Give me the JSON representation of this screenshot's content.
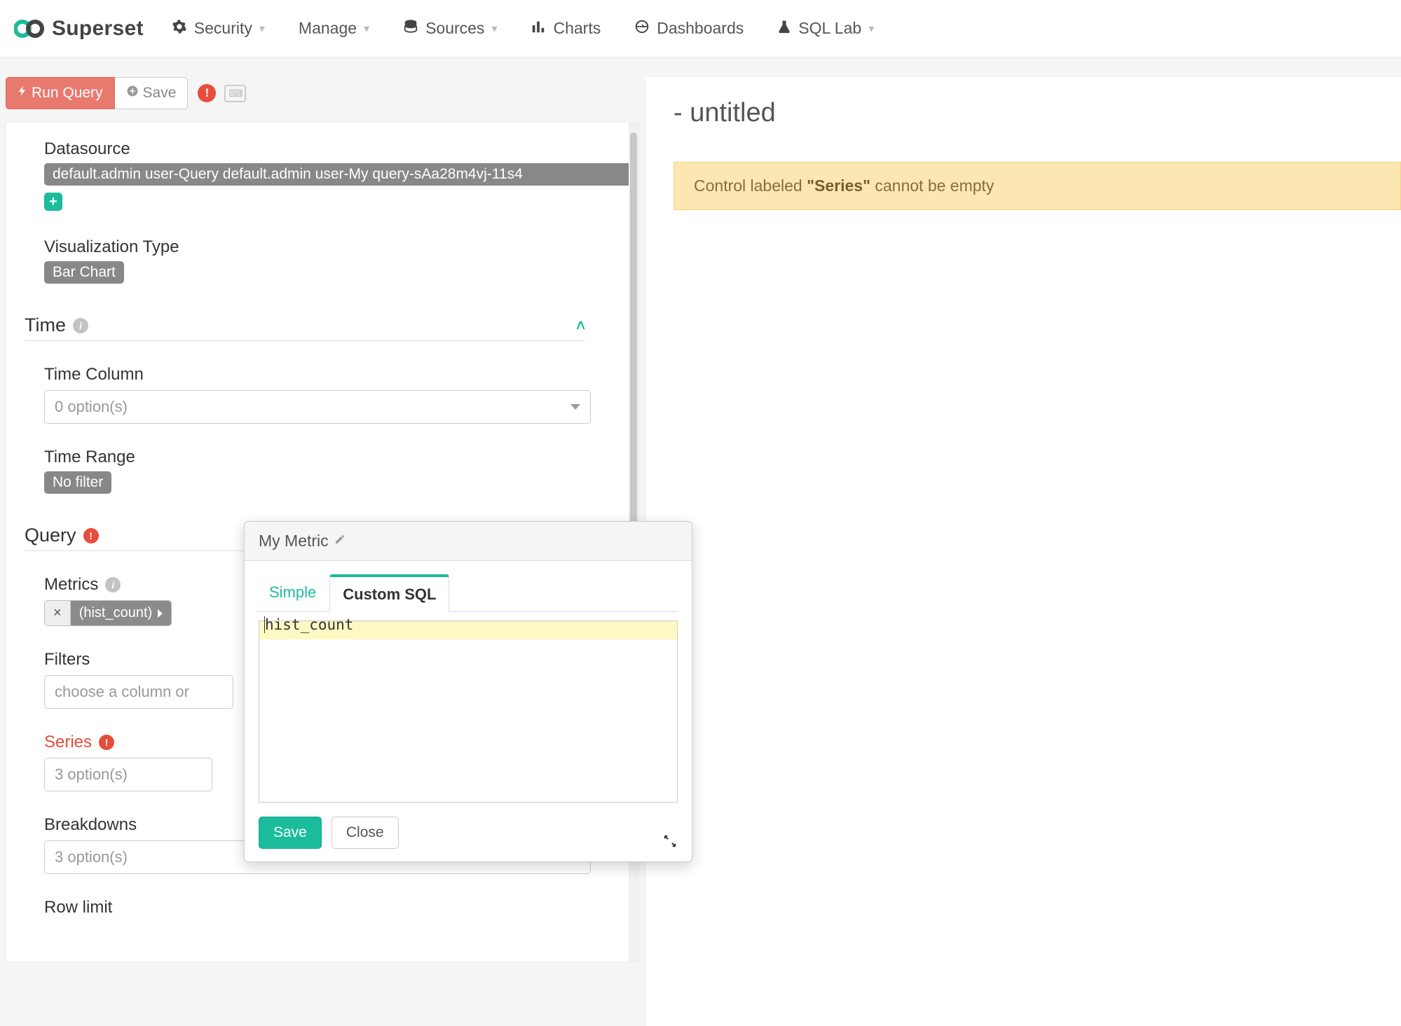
{
  "brand": "Superset",
  "nav": {
    "security": "Security",
    "manage": "Manage",
    "sources": "Sources",
    "charts": "Charts",
    "dashboards": "Dashboards",
    "sqllab": "SQL Lab"
  },
  "toolbar": {
    "run": "Run Query",
    "save": "Save"
  },
  "controls": {
    "datasource": {
      "label": "Datasource",
      "value": "default.admin user-Query default.admin user-My query-sAa28m4vj-11s4"
    },
    "viztype": {
      "label": "Visualization Type",
      "value": "Bar Chart"
    },
    "time_section": "Time",
    "time_column": {
      "label": "Time Column",
      "placeholder": "0 option(s)"
    },
    "time_range": {
      "label": "Time Range",
      "value": "No filter"
    },
    "query_section": "Query",
    "metrics": {
      "label": "Metrics",
      "chip": "(hist_count)"
    },
    "filters": {
      "label": "Filters",
      "placeholder": "choose a column or"
    },
    "series": {
      "label": "Series",
      "placeholder": "3 option(s)"
    },
    "breakdowns": {
      "label": "Breakdowns",
      "placeholder": "3 option(s)"
    },
    "rowlimit": {
      "label": "Row limit"
    }
  },
  "chart": {
    "title": "- untitled",
    "warning_prefix": "Control labeled ",
    "warning_bold": "\"Series\"",
    "warning_suffix": " cannot be empty"
  },
  "popover": {
    "title": "My Metric",
    "tab_simple": "Simple",
    "tab_custom": "Custom SQL",
    "sql": "hist_count",
    "save": "Save",
    "close": "Close"
  }
}
